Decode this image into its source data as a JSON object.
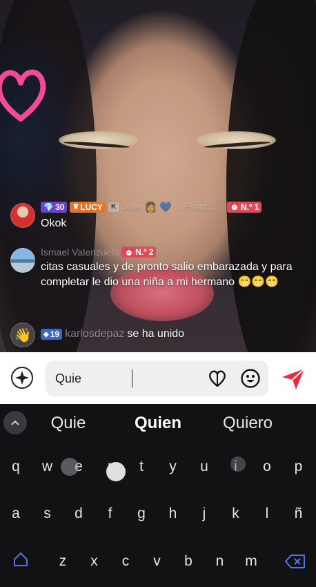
{
  "comments": [
    {
      "badges": [
        "30",
        "LUCY",
        "K"
      ],
      "badge_colors": [
        "#6a44c8",
        "#e2742c",
        "#c8c8d2"
      ],
      "username": "Jose 👩 💙 ... Franc...",
      "rank": "N.º 1",
      "text": "Okok"
    },
    {
      "username": "Ismael Valenzuela",
      "rank": "N.º 2",
      "text": "citas casuales y de pronto salio embarazada y para completar le dio una niña a mi hermano 😁😁😁"
    },
    {
      "badge": "19",
      "username": "karlosdepaz",
      "action": "se ha unido"
    }
  ],
  "input": {
    "value": "Quie"
  },
  "keyboard": {
    "suggestions": [
      "Quie",
      "Quien",
      "Quiero"
    ],
    "row1": [
      "q",
      "w",
      "e",
      "r",
      "t",
      "y",
      "u",
      "i",
      "o",
      "p"
    ],
    "row2": [
      "a",
      "s",
      "d",
      "f",
      "g",
      "h",
      "j",
      "k",
      "l",
      "ñ"
    ],
    "row3": [
      "z",
      "x",
      "c",
      "v",
      "b",
      "n",
      "m"
    ]
  },
  "colors": {
    "send": "#ee2b3c",
    "accent_blue": "#3a66c8",
    "rank_red": "#e0495a",
    "heart_pink": "#f04a98"
  }
}
